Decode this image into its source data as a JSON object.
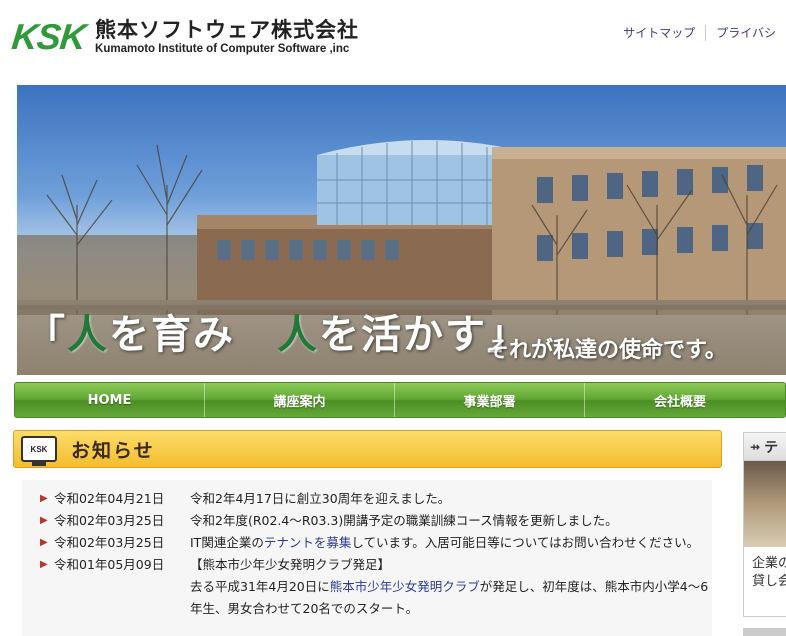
{
  "header": {
    "logo_mark": "KSK",
    "company_jp": "熊本ソフトウェア株式会社",
    "company_en": "Kumamoto Institute of Computer Software ,inc",
    "links": [
      "サイトマップ",
      "プライバシ"
    ]
  },
  "hero": {
    "slogan_open": "「",
    "slogan_hl1": "人",
    "slogan_part1": "を育み　",
    "slogan_hl2": "人",
    "slogan_part2": "を活かす」",
    "slogan_sub": "それが私達の使命です。"
  },
  "nav": {
    "items": [
      "HOME",
      "講座案内",
      "事業部署",
      "会社概要"
    ]
  },
  "news": {
    "icon_label": "KSK",
    "title": "お知らせ",
    "items": [
      {
        "date": "令和02年04月21日",
        "text": "令和2年4月17日に創立30周年を迎えました。"
      },
      {
        "date": "令和02年03月25日",
        "text": "令和2年度(R02.4～R03.3)開講予定の職業訓練コース情報を更新しました。"
      },
      {
        "date": "令和02年03月25日",
        "text_a": "IT関連企業の",
        "text_link": "テナントを募集",
        "text_b": "しています。入居可能日等についてはお問い合わせください。"
      },
      {
        "date": "令和01年05月09日",
        "text_head": "【熊本市少年少女発明クラブ発足】",
        "text_a": "去る平成31年4月20日に",
        "text_link": "熊本市少年少女発明クラブ",
        "text_b": "が発足し、初年度は、熊本市内小学4～6年生、男女合わせて20名でのスタート。"
      }
    ]
  },
  "side": {
    "head": "テ",
    "text1": "企業の",
    "text2": "貸し会"
  },
  "colors": {
    "brand_green": "#2f9a3a",
    "nav_green": "#5fa631",
    "news_yellow": "#f3bd2e",
    "link_blue": "#2b3a9a",
    "arrow_red": "#b03b2a"
  }
}
